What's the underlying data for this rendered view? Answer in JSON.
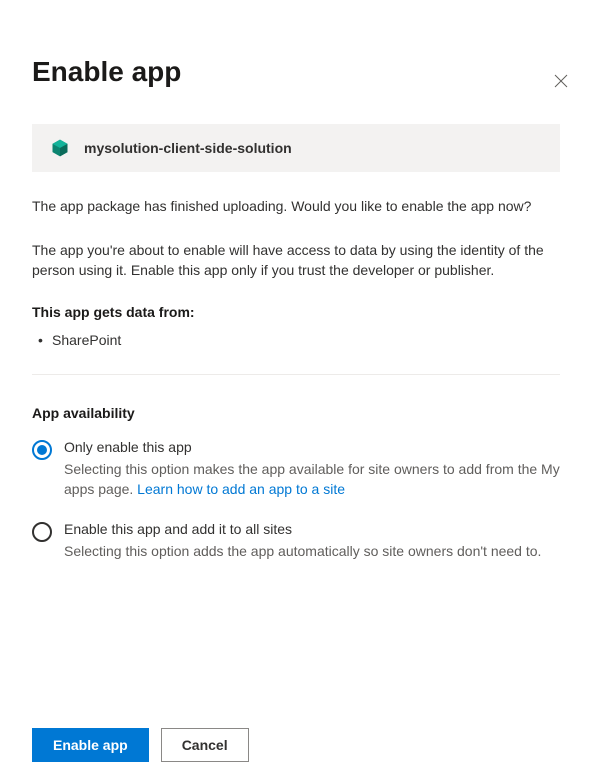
{
  "dialog": {
    "title": "Enable app",
    "package_name": "mysolution-client-side-solution",
    "intro_text": "The app package has finished uploading. Would you like to enable the app now?",
    "trust_text": "The app you're about to enable will have access to data by using the identity of the person using it. Enable this app only if you trust the developer or publisher.",
    "data_sources_label": "This app gets data from:",
    "data_sources": [
      "SharePoint"
    ],
    "availability": {
      "title": "App availability",
      "options": [
        {
          "label": "Only enable this app",
          "description_pre": "Selecting this option makes the app available for site owners to add from the My apps page. ",
          "link_text": "Learn how to add an app to a site",
          "description_post": "",
          "selected": true
        },
        {
          "label": "Enable this app and add it to all sites",
          "description_pre": "Selecting this option adds the app automatically so site owners don't need to.",
          "link_text": "",
          "description_post": "",
          "selected": false
        }
      ]
    },
    "buttons": {
      "primary": "Enable app",
      "secondary": "Cancel"
    }
  }
}
